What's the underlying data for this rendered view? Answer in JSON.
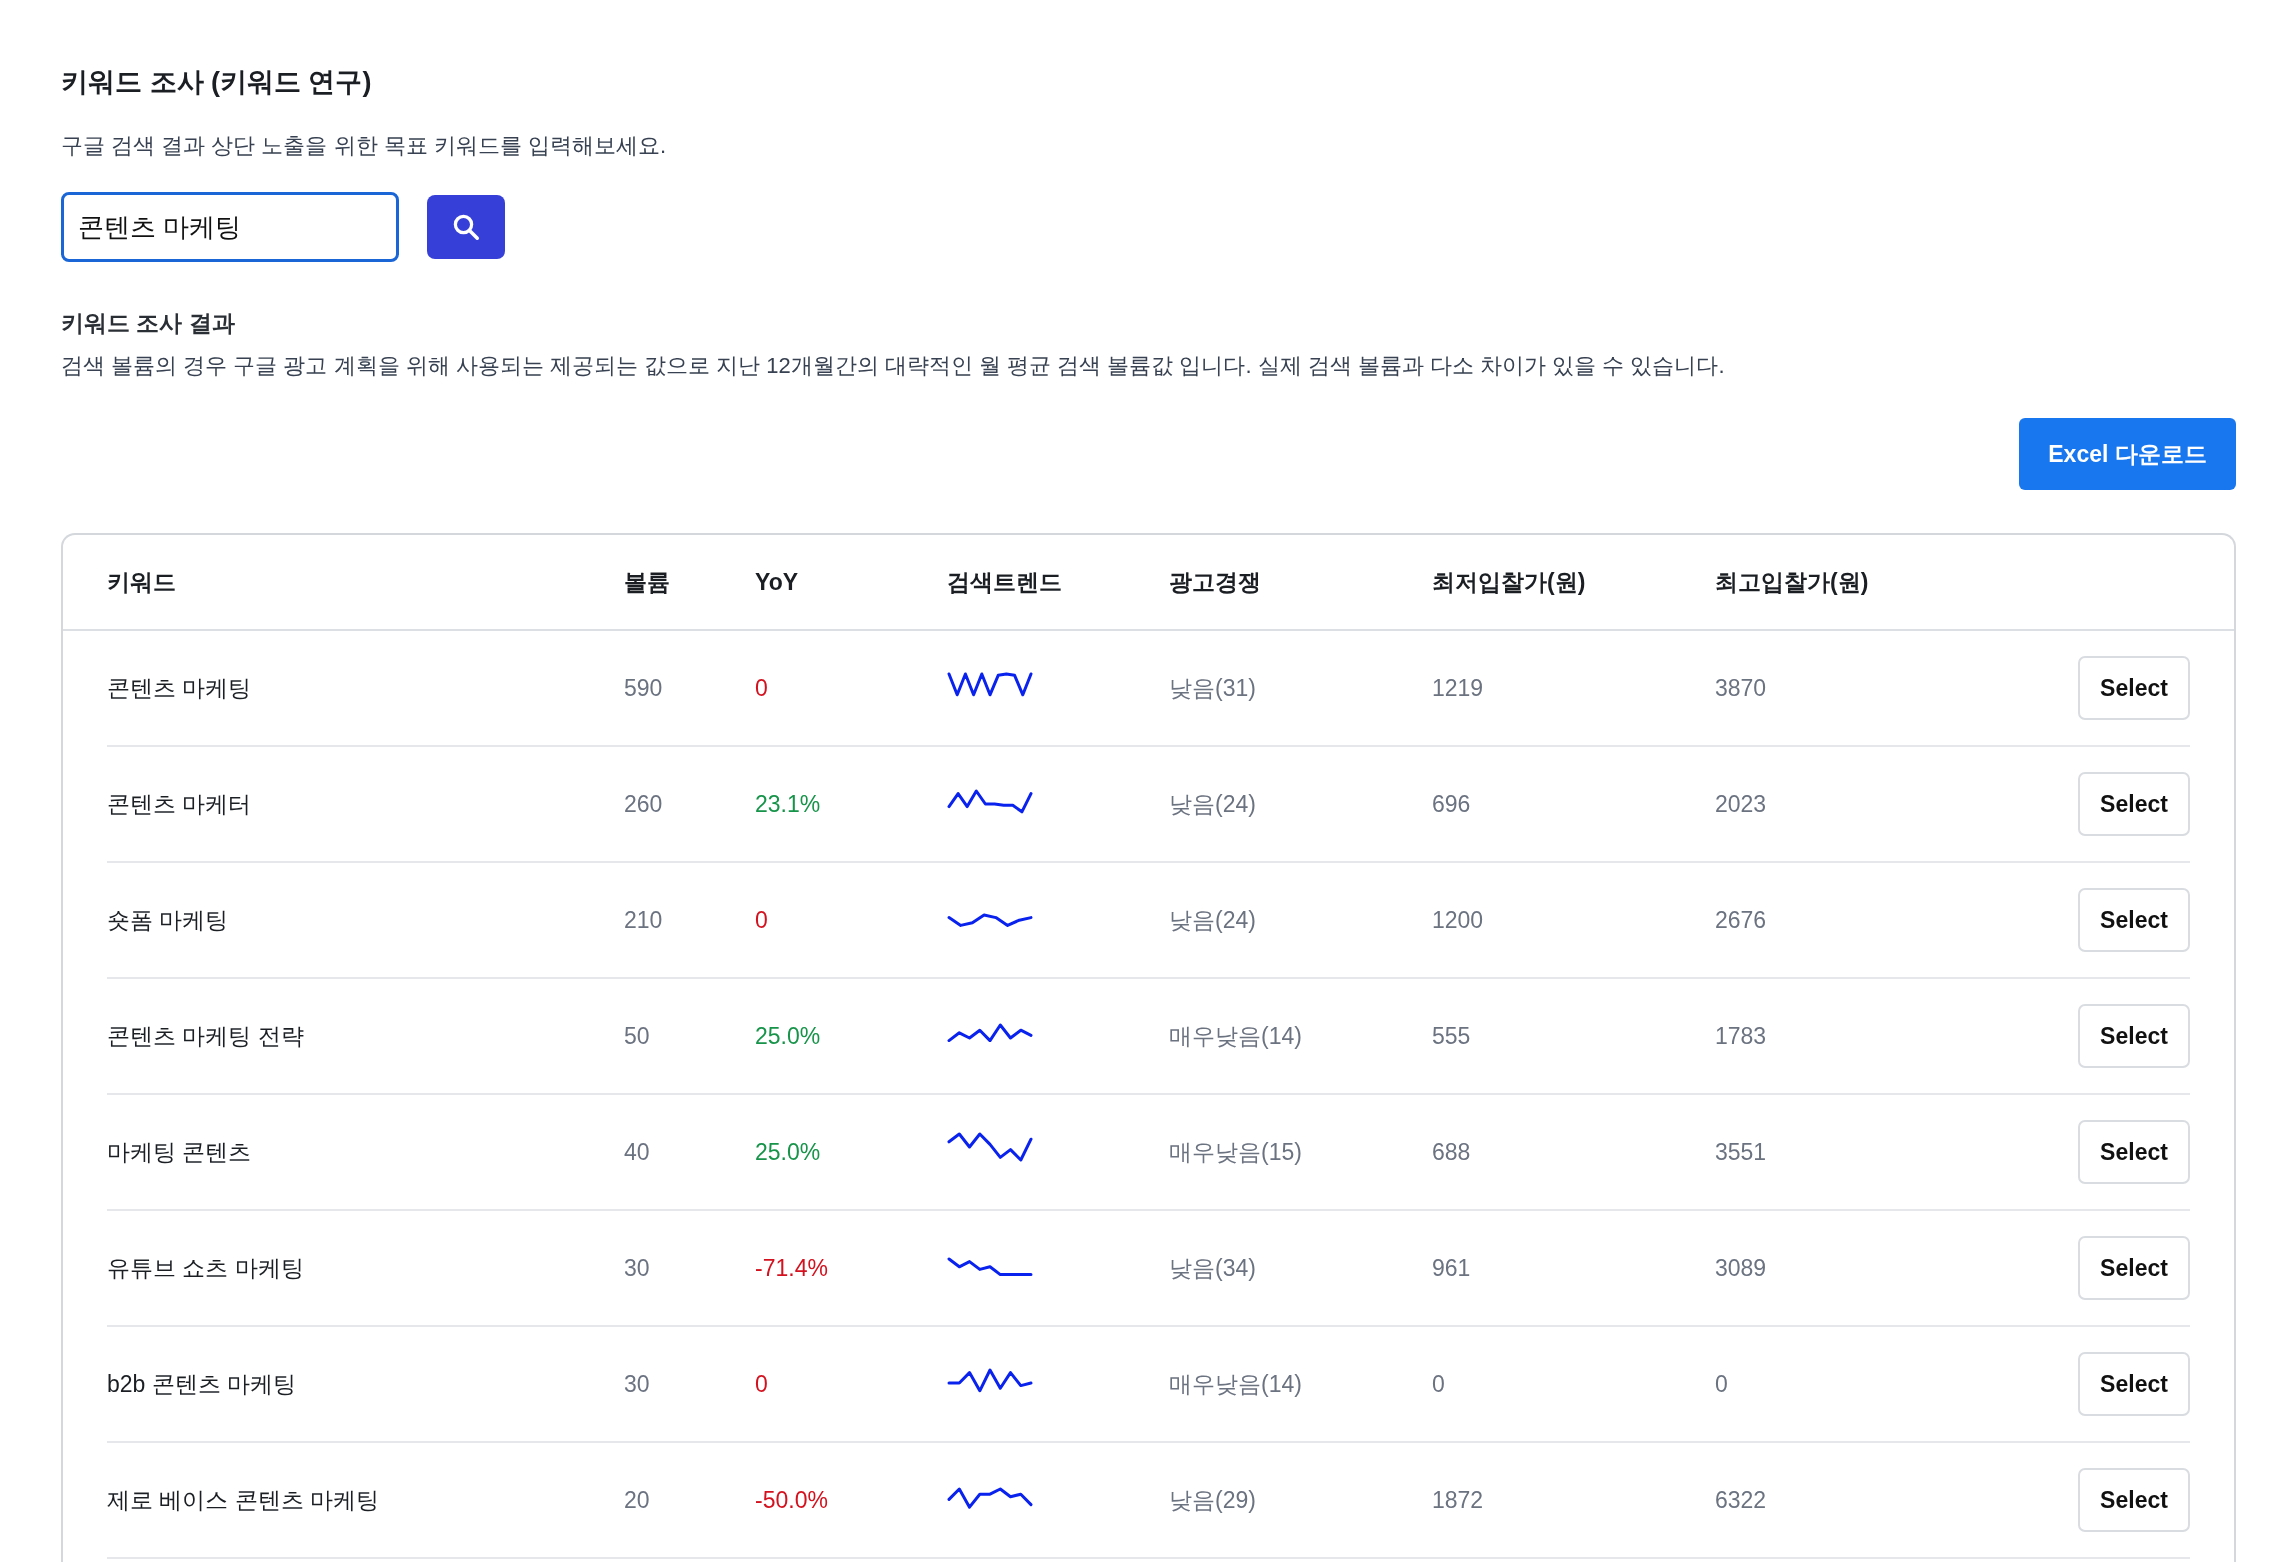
{
  "page": {
    "title": "키워드 조사 (키워드 연구)",
    "subtitle": "구글 검색 결과 상단 노출을 위한 목표 키워드를 입력해보세요."
  },
  "search": {
    "value": "콘텐츠 마케팅"
  },
  "results": {
    "title": "키워드 조사 결과",
    "description": "검색 볼륨의 경우 구글 광고 계획을 위해 사용되는 제공되는 값으로 지난 12개월간의 대략적인 월 평균 검색 볼륨값 입니다. 실제 검색 볼륨과 다소 차이가 있을 수 있습니다.",
    "download_button": "Excel 다운로드"
  },
  "table": {
    "columns": [
      "키워드",
      "볼륨",
      "YoY",
      "검색트렌드",
      "광고경쟁",
      "최저입찰가(원)",
      "최고입찰가(원)"
    ],
    "rows": [
      {
        "keyword": "콘텐츠 마케팅",
        "volume": "590",
        "yoy": "0",
        "color": "#d4111e",
        "competition": "낮음(31)",
        "min_bid": "1219",
        "max_bid": "3870",
        "action": "Select"
      },
      {
        "keyword": "콘텐츠 마케터",
        "volume": "260",
        "yoy": "23.1%",
        "color": "#17944a",
        "competition": "낮음(24)",
        "min_bid": "696",
        "max_bid": "2023",
        "action": "Select"
      },
      {
        "keyword": "숏폼 마케팅",
        "volume": "210",
        "yoy": "0",
        "color": "#d4111e",
        "competition": "낮음(24)",
        "min_bid": "1200",
        "max_bid": "2676",
        "action": "Select"
      },
      {
        "keyword": "콘텐츠 마케팅 전략",
        "volume": "50",
        "yoy": "25.0%",
        "color": "#17944a",
        "competition": "매우낮음(14)",
        "min_bid": "555",
        "max_bid": "1783",
        "action": "Select"
      },
      {
        "keyword": "마케팅 콘텐츠",
        "volume": "40",
        "yoy": "25.0%",
        "color": "#17944a",
        "competition": "매우낮음(15)",
        "min_bid": "688",
        "max_bid": "3551",
        "action": "Select"
      },
      {
        "keyword": "유튜브 쇼츠 마케팅",
        "volume": "30",
        "yoy": "-71.4%",
        "color": "#d4111e",
        "competition": "낮음(34)",
        "min_bid": "961",
        "max_bid": "3089",
        "action": "Select"
      },
      {
        "keyword": "b2b 콘텐츠 마케팅",
        "volume": "30",
        "yoy": "0",
        "color": "#d4111e",
        "competition": "매우낮음(14)",
        "min_bid": "0",
        "max_bid": "0",
        "action": "Select"
      },
      {
        "keyword": "제로 베이스 콘텐츠 마케팅",
        "volume": "20",
        "yoy": "-50.0%",
        "color": "#d4111e",
        "competition": "낮음(29)",
        "min_bid": "1872",
        "max_bid": "6322",
        "action": "Select"
      }
    ]
  }
}
